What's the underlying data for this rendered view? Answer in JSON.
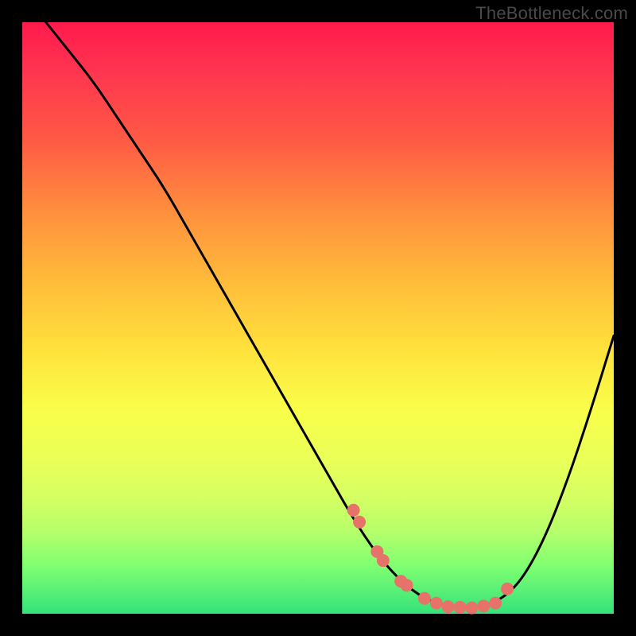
{
  "watermark": "TheBottleneck.com",
  "chart_data": {
    "type": "line",
    "title": "",
    "xlabel": "",
    "ylabel": "",
    "xlim": [
      0,
      100
    ],
    "ylim": [
      0,
      100
    ],
    "series": [
      {
        "name": "curve",
        "x": [
          4,
          8,
          12,
          16,
          20,
          24,
          28,
          32,
          36,
          40,
          44,
          48,
          52,
          56,
          60,
          64,
          68,
          72,
          76,
          80,
          84,
          88,
          92,
          96,
          100
        ],
        "y": [
          100,
          95,
          90,
          84,
          78,
          72,
          65,
          58,
          51,
          44,
          37,
          30,
          23,
          16,
          10,
          5.5,
          2.5,
          1.2,
          1.0,
          1.8,
          5,
          12,
          22,
          34,
          47
        ]
      }
    ],
    "points": {
      "name": "markers",
      "x": [
        56,
        57,
        60,
        61,
        64,
        65,
        68,
        70,
        72,
        74,
        76,
        78,
        80,
        82
      ],
      "y": [
        17.5,
        15.5,
        10.5,
        9,
        5.5,
        4.8,
        2.6,
        1.8,
        1.2,
        1.1,
        1.0,
        1.3,
        1.8,
        4.2
      ]
    },
    "colors": {
      "curve": "#000000",
      "markers": "#e77269"
    }
  }
}
